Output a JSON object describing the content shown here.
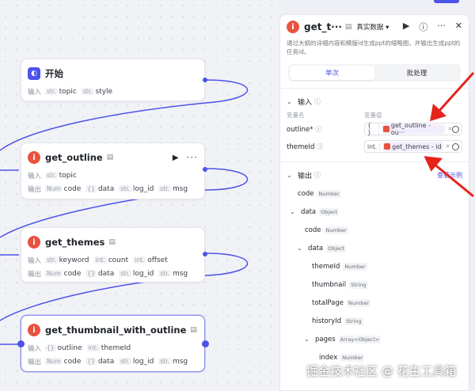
{
  "nodes": {
    "start": {
      "icon": "start-icon",
      "title": "开始",
      "inputs_label": "输入",
      "inputs": [
        {
          "type": "str.",
          "name": "topic"
        },
        {
          "type": "str.",
          "name": "style"
        }
      ]
    },
    "get_outline": {
      "title": "get_outline",
      "inputs_label": "输入",
      "outputs_label": "输出",
      "inputs": [
        {
          "type": "str.",
          "name": "topic"
        }
      ],
      "outputs": [
        {
          "type": "Num",
          "name": "code"
        },
        {
          "type": "{}",
          "name": "data"
        },
        {
          "type": "str.",
          "name": "log_id"
        },
        {
          "type": "str.",
          "name": "msg"
        }
      ]
    },
    "get_themes": {
      "title": "get_themes",
      "inputs_label": "输入",
      "outputs_label": "输出",
      "inputs": [
        {
          "type": "str.",
          "name": "keyword"
        },
        {
          "type": "int.",
          "name": "count"
        },
        {
          "type": "int.",
          "name": "offset"
        }
      ],
      "outputs": [
        {
          "type": "Num",
          "name": "code"
        },
        {
          "type": "{}",
          "name": "data"
        },
        {
          "type": "str.",
          "name": "log_id"
        },
        {
          "type": "str.",
          "name": "msg"
        }
      ]
    },
    "get_thumbnail": {
      "title": "get_thumbnail_with_outline",
      "inputs_label": "输入",
      "outputs_label": "输出",
      "inputs": [
        {
          "type": "{}",
          "name": "outline"
        },
        {
          "type": "int.",
          "name": "themeId"
        }
      ],
      "outputs": [
        {
          "type": "Num",
          "name": "code"
        },
        {
          "type": "{}",
          "name": "data"
        },
        {
          "type": "str.",
          "name": "log_id"
        },
        {
          "type": "str.",
          "name": "msg"
        }
      ]
    }
  },
  "panel": {
    "title": "get_t···",
    "data_mode": "真实数据",
    "description": "通过大纲的详细内容和模版id生成ppt的缩略图，并输出生成ppt的任务id。",
    "tabs": [
      "单次",
      "批处理"
    ],
    "input_section": "输入",
    "col_var_name": "变量名",
    "col_var_value": "变量值",
    "inputs": [
      {
        "name": "outline*",
        "type": "{ }",
        "ref": "get_outline - ou···"
      },
      {
        "name": "themeId",
        "type": "int.",
        "ref": "get_themes - id"
      }
    ],
    "output_section": "输出",
    "example_link": "查看示例",
    "outputs": [
      {
        "name": "code",
        "type": "Number",
        "level": 0,
        "expand": false
      },
      {
        "name": "data",
        "type": "Object",
        "level": 0,
        "expand": true
      },
      {
        "name": "code",
        "type": "Number",
        "level": 1,
        "expand": false
      },
      {
        "name": "data",
        "type": "Object",
        "level": 1,
        "expand": true
      },
      {
        "name": "themeId",
        "type": "Number",
        "level": 2,
        "expand": false
      },
      {
        "name": "thumbnail",
        "type": "String",
        "level": 2,
        "expand": false
      },
      {
        "name": "totalPage",
        "type": "Number",
        "level": 2,
        "expand": false
      },
      {
        "name": "historyId",
        "type": "String",
        "level": 2,
        "expand": false
      },
      {
        "name": "pages",
        "type": "Array<Object>",
        "level": 2,
        "expand": true
      },
      {
        "name": "index",
        "type": "Number",
        "level": 3,
        "expand": false
      }
    ]
  },
  "watermark": "掘金技术社区 @ 花生工具箱",
  "colors": {
    "accent": "#4d53e8",
    "plugin_icon": "#e8523f",
    "arrow": "#e5231b"
  }
}
